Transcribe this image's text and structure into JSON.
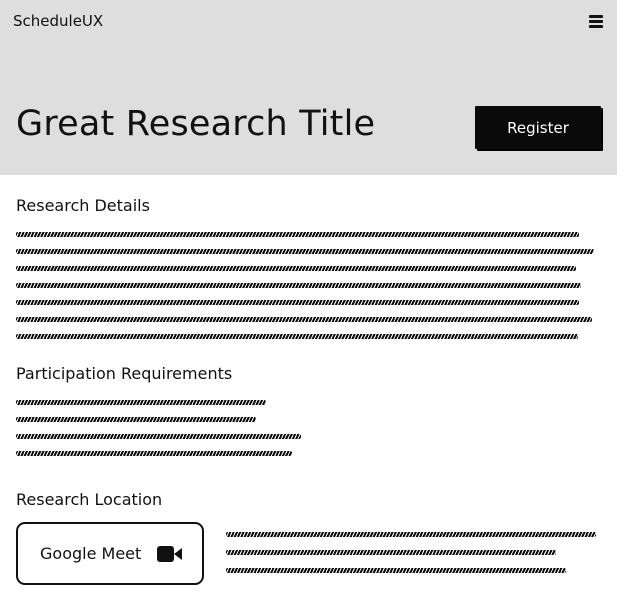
{
  "header": {
    "brand": "ScheduleUX",
    "menu_icon": "hamburger-menu-icon",
    "title": "Great Research Title",
    "register_label": "Register",
    "background_color": "#dedede",
    "button_color": "#0a0a0a"
  },
  "sections": {
    "details_title": "Research Details",
    "requirements_title": "Participation Requirements",
    "location_title": "Research Location"
  },
  "location": {
    "label": "Google Meet",
    "icon": "video-camera-icon"
  }
}
